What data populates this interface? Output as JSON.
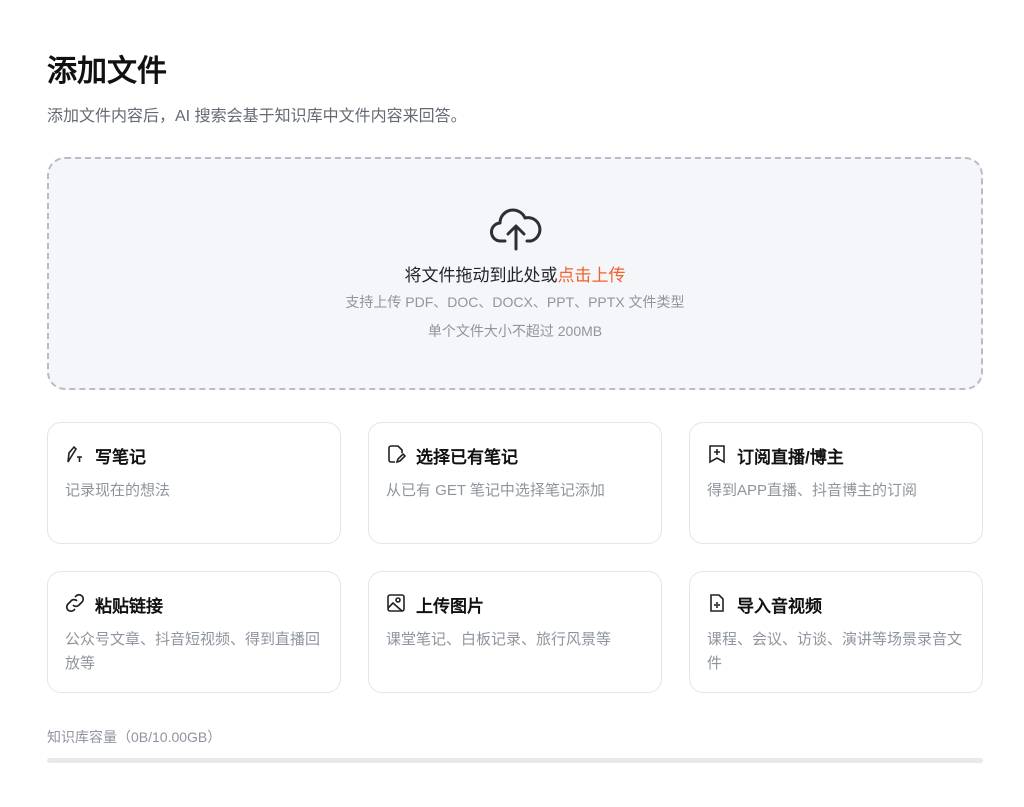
{
  "header": {
    "title": "添加文件",
    "subtitle": "添加文件内容后，AI 搜索会基于知识库中文件内容来回答。"
  },
  "dropzone": {
    "main": "将文件拖动到此处或",
    "link": "点击上传",
    "formats": "支持上传 PDF、DOC、DOCX、PPT、PPTX 文件类型",
    "size_limit": "单个文件大小不超过 200MB"
  },
  "cards": [
    {
      "title": "写笔记",
      "desc": "记录现在的想法",
      "icon": "pen-icon"
    },
    {
      "title": "选择已有笔记",
      "desc": "从已有 GET 笔记中选择笔记添加",
      "icon": "note-icon"
    },
    {
      "title": "订阅直播/博主",
      "desc": "得到APP直播、抖音博主的订阅",
      "icon": "bookmark-plus-icon"
    },
    {
      "title": "粘贴链接",
      "desc": "公众号文章、抖音短视频、得到直播回放等",
      "icon": "link-icon"
    },
    {
      "title": "上传图片",
      "desc": "课堂笔记、白板记录、旅行风景等",
      "icon": "image-icon"
    },
    {
      "title": "导入音视频",
      "desc": "课程、会议、访谈、演讲等场景录音文件",
      "icon": "audio-file-icon"
    }
  ],
  "capacity": {
    "label": "知识库容量（0B/10.00GB）",
    "used_fraction": 0
  },
  "colors": {
    "accent": "#f4602c"
  }
}
